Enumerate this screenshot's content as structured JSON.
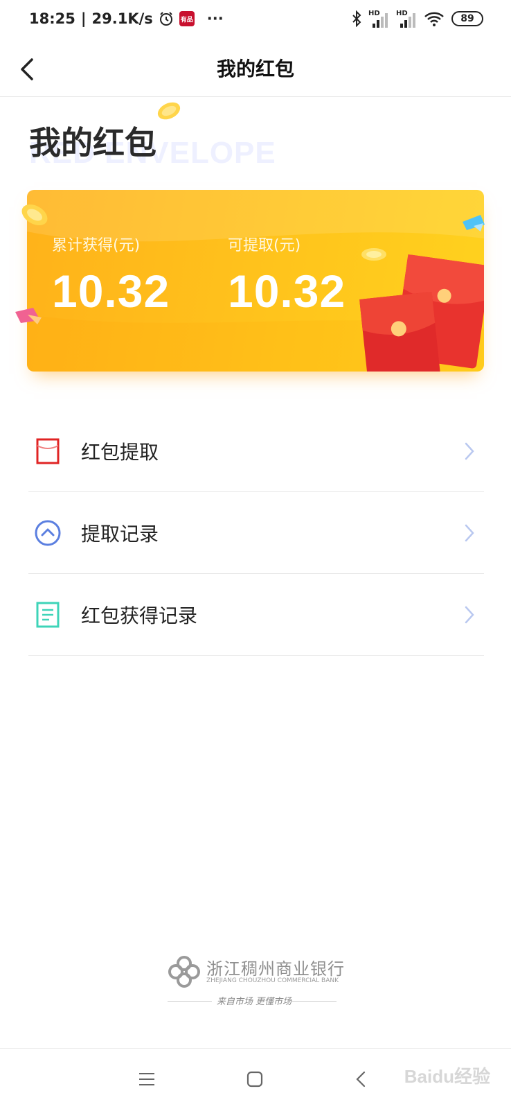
{
  "status_bar": {
    "time": "18:25",
    "speed": "29.1K/s",
    "app_badge": "有品",
    "more": "···",
    "network_1": "HD",
    "network_2": "HD",
    "battery": "89"
  },
  "nav": {
    "title": "我的红包"
  },
  "header": {
    "heading": "我的红包",
    "watermark": "RED ENVELOPE"
  },
  "summary_card": {
    "total_label": "累计获得(元)",
    "total_value": "10.32",
    "withdrawable_label": "可提取(元)",
    "withdrawable_value": "10.32",
    "colors": {
      "start": "#ffb21a",
      "end": "#ffd21e",
      "envelope": "#e8332e"
    }
  },
  "menu": {
    "items": [
      {
        "label": "红包提取",
        "icon": "red-envelope-icon",
        "color": "#e02424"
      },
      {
        "label": "提取记录",
        "icon": "withdraw-record-icon",
        "color": "#5b7fe0"
      },
      {
        "label": "红包获得记录",
        "icon": "receipt-icon",
        "color": "#3ed4b8"
      }
    ]
  },
  "bank": {
    "name": "浙江稠州商业银行",
    "english": "ZHEJIANG CHOUZHOU COMMERCIAL BANK",
    "slogan": "来自市场 更懂市场"
  },
  "system_nav": {
    "menu_icon": "menu-icon",
    "home_icon": "home-icon",
    "back_icon": "back-icon",
    "watermark": "Baidu经验"
  }
}
